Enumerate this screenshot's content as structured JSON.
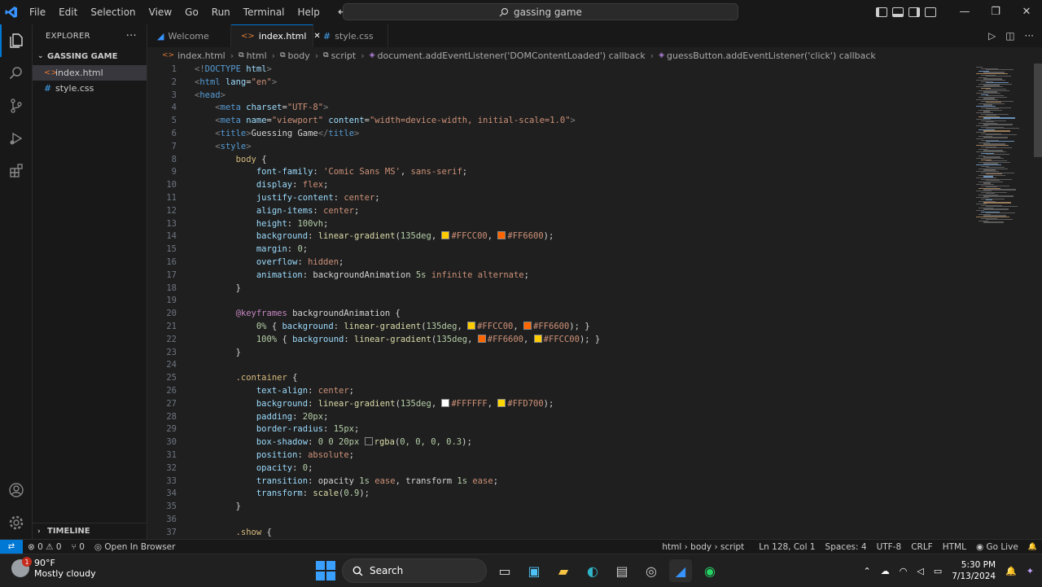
{
  "titlebar": {
    "menus": [
      "File",
      "Edit",
      "Selection",
      "View",
      "Go",
      "Run",
      "Terminal",
      "Help"
    ],
    "search_text": "gassing game",
    "window_buttons": [
      "—",
      "❐",
      "✕"
    ]
  },
  "sidebar": {
    "header": "EXPLORER",
    "more": "···",
    "folder": "GASSING GAME",
    "files": [
      {
        "name": "index.html",
        "type": "html",
        "selected": true
      },
      {
        "name": "style.css",
        "type": "css",
        "selected": false
      }
    ],
    "timeline": "TIMELINE"
  },
  "tabs": [
    {
      "label": "Welcome",
      "icon": "vscode-icon",
      "active": false
    },
    {
      "label": "index.html",
      "icon": "html-icon",
      "active": true,
      "close": "✕"
    },
    {
      "label": "style.css",
      "icon": "css-icon",
      "active": false
    }
  ],
  "breadcrumb": [
    "index.html",
    "html",
    "body",
    "script",
    "document.addEventListener('DOMContentLoaded') callback",
    "guessButton.addEventListener('click') callback"
  ],
  "code_lines": [
    {
      "n": "1",
      "tokens": [
        [
          "tok-punct",
          "<!"
        ],
        [
          "tok-tag",
          "DOCTYPE"
        ],
        [
          "tok-attr",
          " html"
        ],
        [
          "tok-punct",
          ">"
        ]
      ]
    },
    {
      "n": "2",
      "tokens": [
        [
          "tok-punct",
          "<"
        ],
        [
          "tok-tag",
          "html"
        ],
        [
          "tok-attr",
          " lang"
        ],
        [
          "tok-text",
          "="
        ],
        [
          "tok-str",
          "\"en\""
        ],
        [
          "tok-punct",
          ">"
        ]
      ]
    },
    {
      "n": "3",
      "tokens": [
        [
          "tok-punct",
          "<"
        ],
        [
          "tok-tag",
          "head"
        ],
        [
          "tok-punct",
          ">"
        ]
      ]
    },
    {
      "n": "4",
      "tokens": [
        [
          "tok-text",
          "    "
        ],
        [
          "tok-punct",
          "<"
        ],
        [
          "tok-tag",
          "meta"
        ],
        [
          "tok-attr",
          " charset"
        ],
        [
          "tok-text",
          "="
        ],
        [
          "tok-str",
          "\"UTF-8\""
        ],
        [
          "tok-punct",
          ">"
        ]
      ]
    },
    {
      "n": "5",
      "tokens": [
        [
          "tok-text",
          "    "
        ],
        [
          "tok-punct",
          "<"
        ],
        [
          "tok-tag",
          "meta"
        ],
        [
          "tok-attr",
          " name"
        ],
        [
          "tok-text",
          "="
        ],
        [
          "tok-str",
          "\"viewport\""
        ],
        [
          "tok-attr",
          " content"
        ],
        [
          "tok-text",
          "="
        ],
        [
          "tok-str",
          "\"width=device-width, initial-scale=1.0\""
        ],
        [
          "tok-punct",
          ">"
        ]
      ]
    },
    {
      "n": "6",
      "tokens": [
        [
          "tok-text",
          "    "
        ],
        [
          "tok-punct",
          "<"
        ],
        [
          "tok-tag",
          "title"
        ],
        [
          "tok-punct",
          ">"
        ],
        [
          "tok-text",
          "Guessing Game"
        ],
        [
          "tok-punct",
          "</"
        ],
        [
          "tok-tag",
          "title"
        ],
        [
          "tok-punct",
          ">"
        ]
      ]
    },
    {
      "n": "7",
      "tokens": [
        [
          "tok-text",
          "    "
        ],
        [
          "tok-punct",
          "<"
        ],
        [
          "tok-tag",
          "style"
        ],
        [
          "tok-punct",
          ">"
        ]
      ]
    },
    {
      "n": "8",
      "tokens": [
        [
          "tok-text",
          "        "
        ],
        [
          "tok-sel",
          "body"
        ],
        [
          "tok-text",
          " {"
        ]
      ]
    },
    {
      "n": "9",
      "tokens": [
        [
          "tok-text",
          "            "
        ],
        [
          "tok-prop",
          "font-family"
        ],
        [
          "tok-text",
          ": "
        ],
        [
          "tok-str",
          "'Comic Sans MS'"
        ],
        [
          "tok-text",
          ", "
        ],
        [
          "tok-val",
          "sans-serif"
        ],
        [
          "tok-text",
          ";"
        ]
      ]
    },
    {
      "n": "10",
      "tokens": [
        [
          "tok-text",
          "            "
        ],
        [
          "tok-prop",
          "display"
        ],
        [
          "tok-text",
          ": "
        ],
        [
          "tok-val",
          "flex"
        ],
        [
          "tok-text",
          ";"
        ]
      ]
    },
    {
      "n": "11",
      "tokens": [
        [
          "tok-text",
          "            "
        ],
        [
          "tok-prop",
          "justify-content"
        ],
        [
          "tok-text",
          ": "
        ],
        [
          "tok-val",
          "center"
        ],
        [
          "tok-text",
          ";"
        ]
      ]
    },
    {
      "n": "12",
      "tokens": [
        [
          "tok-text",
          "            "
        ],
        [
          "tok-prop",
          "align-items"
        ],
        [
          "tok-text",
          ": "
        ],
        [
          "tok-val",
          "center"
        ],
        [
          "tok-text",
          ";"
        ]
      ]
    },
    {
      "n": "13",
      "tokens": [
        [
          "tok-text",
          "            "
        ],
        [
          "tok-prop",
          "height"
        ],
        [
          "tok-text",
          ": "
        ],
        [
          "tok-num",
          "100vh"
        ],
        [
          "tok-text",
          ";"
        ]
      ]
    },
    {
      "n": "14",
      "tokens": [
        [
          "tok-text",
          "            "
        ],
        [
          "tok-prop",
          "background"
        ],
        [
          "tok-text",
          ": "
        ],
        [
          "tok-fn",
          "linear-gradient"
        ],
        [
          "tok-text",
          "("
        ],
        [
          "tok-num",
          "135deg"
        ],
        [
          "tok-text",
          ", "
        ],
        [
          "swatch",
          "#FFCC00"
        ],
        [
          "tok-val",
          "#FFCC00"
        ],
        [
          "tok-text",
          ", "
        ],
        [
          "swatch",
          "#FF6600"
        ],
        [
          "tok-val",
          "#FF6600"
        ],
        [
          "tok-text",
          ");"
        ]
      ]
    },
    {
      "n": "15",
      "tokens": [
        [
          "tok-text",
          "            "
        ],
        [
          "tok-prop",
          "margin"
        ],
        [
          "tok-text",
          ": "
        ],
        [
          "tok-num",
          "0"
        ],
        [
          "tok-text",
          ";"
        ]
      ]
    },
    {
      "n": "16",
      "tokens": [
        [
          "tok-text",
          "            "
        ],
        [
          "tok-prop",
          "overflow"
        ],
        [
          "tok-text",
          ": "
        ],
        [
          "tok-val",
          "hidden"
        ],
        [
          "tok-text",
          ";"
        ]
      ]
    },
    {
      "n": "17",
      "tokens": [
        [
          "tok-text",
          "            "
        ],
        [
          "tok-prop",
          "animation"
        ],
        [
          "tok-text",
          ": backgroundAnimation "
        ],
        [
          "tok-num",
          "5s"
        ],
        [
          "tok-val",
          " infinite alternate"
        ],
        [
          "tok-text",
          ";"
        ]
      ]
    },
    {
      "n": "18",
      "tokens": [
        [
          "tok-text",
          "        }"
        ]
      ]
    },
    {
      "n": "19",
      "tokens": []
    },
    {
      "n": "20",
      "tokens": [
        [
          "tok-text",
          "        "
        ],
        [
          "tok-kw",
          "@keyframes"
        ],
        [
          "tok-text",
          " backgroundAnimation {"
        ]
      ]
    },
    {
      "n": "21",
      "tokens": [
        [
          "tok-text",
          "            "
        ],
        [
          "tok-num",
          "0%"
        ],
        [
          "tok-text",
          " { "
        ],
        [
          "tok-prop",
          "background"
        ],
        [
          "tok-text",
          ": "
        ],
        [
          "tok-fn",
          "linear-gradient"
        ],
        [
          "tok-text",
          "("
        ],
        [
          "tok-num",
          "135deg"
        ],
        [
          "tok-text",
          ", "
        ],
        [
          "swatch",
          "#FFCC00"
        ],
        [
          "tok-val",
          "#FFCC00"
        ],
        [
          "tok-text",
          ", "
        ],
        [
          "swatch",
          "#FF6600"
        ],
        [
          "tok-val",
          "#FF6600"
        ],
        [
          "tok-text",
          "); }"
        ]
      ]
    },
    {
      "n": "22",
      "tokens": [
        [
          "tok-text",
          "            "
        ],
        [
          "tok-num",
          "100%"
        ],
        [
          "tok-text",
          " { "
        ],
        [
          "tok-prop",
          "background"
        ],
        [
          "tok-text",
          ": "
        ],
        [
          "tok-fn",
          "linear-gradient"
        ],
        [
          "tok-text",
          "("
        ],
        [
          "tok-num",
          "135deg"
        ],
        [
          "tok-text",
          ", "
        ],
        [
          "swatch",
          "#FF6600"
        ],
        [
          "tok-val",
          "#FF6600"
        ],
        [
          "tok-text",
          ", "
        ],
        [
          "swatch",
          "#FFCC00"
        ],
        [
          "tok-val",
          "#FFCC00"
        ],
        [
          "tok-text",
          "); }"
        ]
      ]
    },
    {
      "n": "23",
      "tokens": [
        [
          "tok-text",
          "        }"
        ]
      ]
    },
    {
      "n": "24",
      "tokens": []
    },
    {
      "n": "25",
      "tokens": [
        [
          "tok-text",
          "        "
        ],
        [
          "tok-sel",
          ".container"
        ],
        [
          "tok-text",
          " {"
        ]
      ]
    },
    {
      "n": "26",
      "tokens": [
        [
          "tok-text",
          "            "
        ],
        [
          "tok-prop",
          "text-align"
        ],
        [
          "tok-text",
          ": "
        ],
        [
          "tok-val",
          "center"
        ],
        [
          "tok-text",
          ";"
        ]
      ]
    },
    {
      "n": "27",
      "tokens": [
        [
          "tok-text",
          "            "
        ],
        [
          "tok-prop",
          "background"
        ],
        [
          "tok-text",
          ": "
        ],
        [
          "tok-fn",
          "linear-gradient"
        ],
        [
          "tok-text",
          "("
        ],
        [
          "tok-num",
          "135deg"
        ],
        [
          "tok-text",
          ", "
        ],
        [
          "swatch",
          "#FFFFFF"
        ],
        [
          "tok-val",
          "#FFFFFF"
        ],
        [
          "tok-text",
          ", "
        ],
        [
          "swatch",
          "#FFD700"
        ],
        [
          "tok-val",
          "#FFD700"
        ],
        [
          "tok-text",
          ");"
        ]
      ]
    },
    {
      "n": "28",
      "tokens": [
        [
          "tok-text",
          "            "
        ],
        [
          "tok-prop",
          "padding"
        ],
        [
          "tok-text",
          ": "
        ],
        [
          "tok-num",
          "20px"
        ],
        [
          "tok-text",
          ";"
        ]
      ]
    },
    {
      "n": "29",
      "tokens": [
        [
          "tok-text",
          "            "
        ],
        [
          "tok-prop",
          "border-radius"
        ],
        [
          "tok-text",
          ": "
        ],
        [
          "tok-num",
          "15px"
        ],
        [
          "tok-text",
          ";"
        ]
      ]
    },
    {
      "n": "30",
      "tokens": [
        [
          "tok-text",
          "            "
        ],
        [
          "tok-prop",
          "box-shadow"
        ],
        [
          "tok-text",
          ": "
        ],
        [
          "tok-num",
          "0 0 20px "
        ],
        [
          "swatch",
          "transparent"
        ],
        [
          "tok-fn",
          "rgba"
        ],
        [
          "tok-text",
          "("
        ],
        [
          "tok-num",
          "0, 0, 0, 0.3"
        ],
        [
          "tok-text",
          ");"
        ]
      ]
    },
    {
      "n": "31",
      "tokens": [
        [
          "tok-text",
          "            "
        ],
        [
          "tok-prop",
          "position"
        ],
        [
          "tok-text",
          ": "
        ],
        [
          "tok-val",
          "absolute"
        ],
        [
          "tok-text",
          ";"
        ]
      ]
    },
    {
      "n": "32",
      "tokens": [
        [
          "tok-text",
          "            "
        ],
        [
          "tok-prop",
          "opacity"
        ],
        [
          "tok-text",
          ": "
        ],
        [
          "tok-num",
          "0"
        ],
        [
          "tok-text",
          ";"
        ]
      ]
    },
    {
      "n": "33",
      "tokens": [
        [
          "tok-text",
          "            "
        ],
        [
          "tok-prop",
          "transition"
        ],
        [
          "tok-text",
          ": opacity "
        ],
        [
          "tok-num",
          "1s"
        ],
        [
          "tok-val",
          " ease"
        ],
        [
          "tok-text",
          ", transform "
        ],
        [
          "tok-num",
          "1s"
        ],
        [
          "tok-val",
          " ease"
        ],
        [
          "tok-text",
          ";"
        ]
      ]
    },
    {
      "n": "34",
      "tokens": [
        [
          "tok-text",
          "            "
        ],
        [
          "tok-prop",
          "transform"
        ],
        [
          "tok-text",
          ": "
        ],
        [
          "tok-fn",
          "scale"
        ],
        [
          "tok-text",
          "("
        ],
        [
          "tok-num",
          "0.9"
        ],
        [
          "tok-text",
          ");"
        ]
      ]
    },
    {
      "n": "35",
      "tokens": [
        [
          "tok-text",
          "        }"
        ]
      ]
    },
    {
      "n": "36",
      "tokens": []
    },
    {
      "n": "37",
      "tokens": [
        [
          "tok-text",
          "        "
        ],
        [
          "tok-sel",
          ".show"
        ],
        [
          "tok-text",
          " {"
        ]
      ]
    }
  ],
  "statusbar": {
    "remote": "⇄",
    "problems": "⊗ 0 ⚠ 0",
    "ports": "⑂ 0",
    "open_browser": "Open In Browser",
    "language_path": "html › body › script",
    "cursor": "Ln 128, Col 1",
    "spaces": "Spaces: 4",
    "encoding": "UTF-8",
    "eol": "CRLF",
    "language": "HTML",
    "golive": "Go Live",
    "bell": "🔔"
  },
  "taskbar": {
    "temp": "90°F",
    "condition": "Mostly cloudy",
    "badge": "1",
    "search": "Search",
    "time": "5:30 PM",
    "date": "7/13/2024"
  }
}
